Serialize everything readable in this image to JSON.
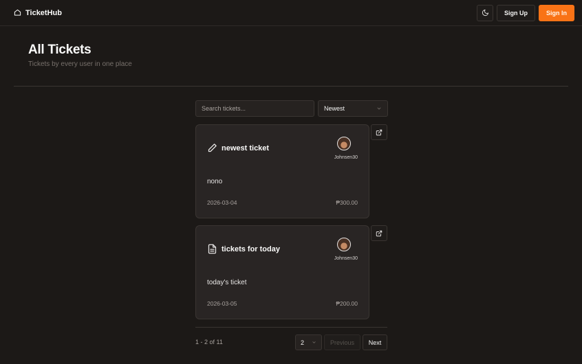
{
  "app": {
    "name": "TicketHub"
  },
  "nav": {
    "theme_toggle_icon": "moon-icon",
    "sign_up": "Sign Up",
    "sign_in": "Sign In"
  },
  "header": {
    "title": "All Tickets",
    "subtitle": "Tickets by every user in one place"
  },
  "filters": {
    "search_placeholder": "Search tickets...",
    "sort_value": "Newest"
  },
  "tickets": [
    {
      "icon": "pencil-icon",
      "title": "newest ticket",
      "author": "Johnsen30",
      "description": "nono",
      "date": "2026-03-04",
      "price": "₱300.00"
    },
    {
      "icon": "document-icon",
      "title": "tickets for today",
      "author": "Johnsen30",
      "description": "today's ticket",
      "date": "2026-03-05",
      "price": "₱200.00"
    }
  ],
  "pagination": {
    "range": "1 - 2 of 11",
    "page_size": "2",
    "previous": "Previous",
    "next": "Next"
  },
  "colors": {
    "accent": "#f97316",
    "background": "#1c1917",
    "card": "#292524",
    "border": "#3a3532"
  }
}
